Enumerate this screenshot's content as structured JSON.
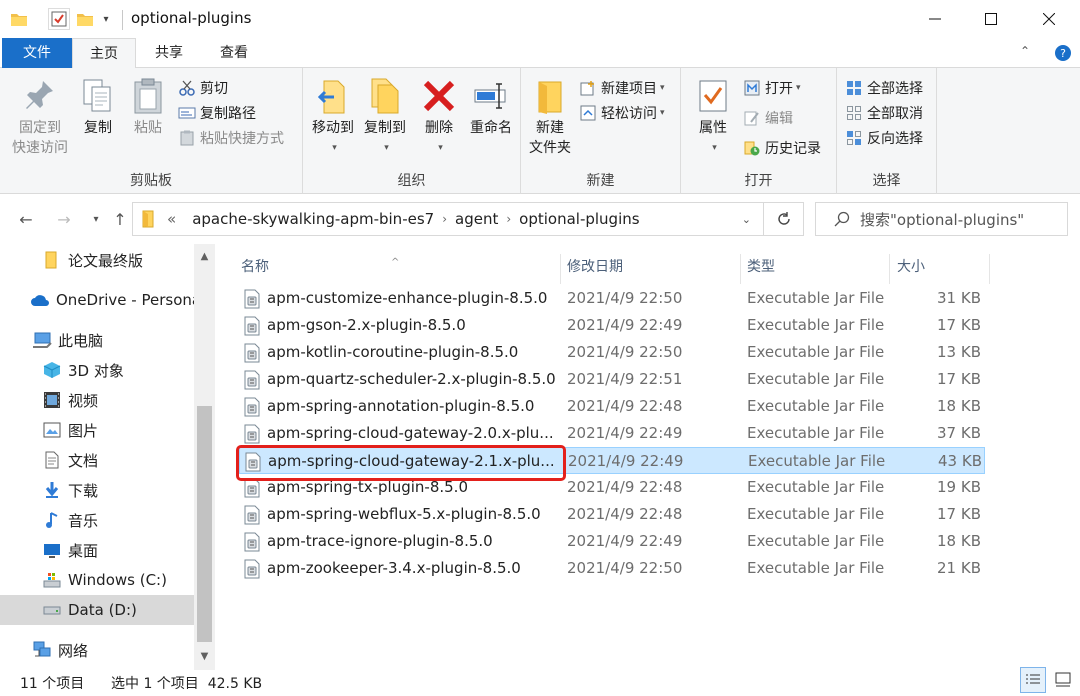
{
  "window": {
    "title": "optional-plugins"
  },
  "tabs": {
    "file": "文件",
    "home": "主页",
    "share": "共享",
    "view": "查看"
  },
  "ribbon": {
    "clipboard": {
      "label": "剪贴板",
      "pin": "固定到\n快速访问",
      "pin_line1": "固定到",
      "pin_line2": "快速访问",
      "copy": "复制",
      "paste": "粘贴",
      "cut": "剪切",
      "copy_path": "复制路径",
      "paste_shortcut": "粘贴快捷方式"
    },
    "organize": {
      "label": "组织",
      "move_to": "移动到",
      "copy_to": "复制到",
      "delete": "删除",
      "rename": "重命名"
    },
    "new": {
      "label": "新建",
      "new_folder_line1": "新建",
      "new_folder_line2": "文件夹",
      "new_item": "新建项目",
      "easy_access": "轻松访问"
    },
    "open": {
      "label": "打开",
      "properties": "属性",
      "open": "打开",
      "edit": "编辑",
      "history": "历史记录"
    },
    "select": {
      "label": "选择",
      "select_all": "全部选择",
      "select_none": "全部取消",
      "invert": "反向选择"
    }
  },
  "address": {
    "overflow": "«",
    "crumbs": [
      "apache-skywalking-apm-bin-es7",
      "agent",
      "optional-plugins"
    ],
    "search_placeholder": "搜索\"optional-plugins\""
  },
  "sidebar": {
    "items": [
      {
        "label": "论文最终版",
        "icon": "folder-icon"
      },
      {
        "label": "OneDrive - Persona",
        "icon": "cloud-icon"
      },
      {
        "label": "此电脑",
        "icon": "computer-icon"
      },
      {
        "label": "3D 对象",
        "icon": "3d-objects-icon"
      },
      {
        "label": "视频",
        "icon": "video-icon"
      },
      {
        "label": "图片",
        "icon": "pictures-icon"
      },
      {
        "label": "文档",
        "icon": "documents-icon"
      },
      {
        "label": "下载",
        "icon": "download-icon"
      },
      {
        "label": "音乐",
        "icon": "music-icon"
      },
      {
        "label": "桌面",
        "icon": "desktop-icon"
      },
      {
        "label": "Windows (C:)",
        "icon": "drive-c-icon"
      },
      {
        "label": "Data (D:)",
        "icon": "drive-d-icon"
      },
      {
        "label": "网络",
        "icon": "network-icon"
      }
    ]
  },
  "filelist": {
    "columns": {
      "name": "名称",
      "date": "修改日期",
      "type": "类型",
      "size": "大小"
    },
    "rows": [
      {
        "name": "apm-customize-enhance-plugin-8.5.0",
        "date": "2021/4/9 22:50",
        "type": "Executable Jar File",
        "size": "31 KB"
      },
      {
        "name": "apm-gson-2.x-plugin-8.5.0",
        "date": "2021/4/9 22:49",
        "type": "Executable Jar File",
        "size": "17 KB"
      },
      {
        "name": "apm-kotlin-coroutine-plugin-8.5.0",
        "date": "2021/4/9 22:50",
        "type": "Executable Jar File",
        "size": "13 KB"
      },
      {
        "name": "apm-quartz-scheduler-2.x-plugin-8.5.0",
        "date": "2021/4/9 22:51",
        "type": "Executable Jar File",
        "size": "17 KB"
      },
      {
        "name": "apm-spring-annotation-plugin-8.5.0",
        "date": "2021/4/9 22:48",
        "type": "Executable Jar File",
        "size": "18 KB"
      },
      {
        "name": "apm-spring-cloud-gateway-2.0.x-plu...",
        "date": "2021/4/9 22:49",
        "type": "Executable Jar File",
        "size": "37 KB"
      },
      {
        "name": "apm-spring-cloud-gateway-2.1.x-plu...",
        "date": "2021/4/9 22:49",
        "type": "Executable Jar File",
        "size": "43 KB"
      },
      {
        "name": "apm-spring-tx-plugin-8.5.0",
        "date": "2021/4/9 22:48",
        "type": "Executable Jar File",
        "size": "19 KB"
      },
      {
        "name": "apm-spring-webflux-5.x-plugin-8.5.0",
        "date": "2021/4/9 22:48",
        "type": "Executable Jar File",
        "size": "17 KB"
      },
      {
        "name": "apm-trace-ignore-plugin-8.5.0",
        "date": "2021/4/9 22:49",
        "type": "Executable Jar File",
        "size": "18 KB"
      },
      {
        "name": "apm-zookeeper-3.4.x-plugin-8.5.0",
        "date": "2021/4/9 22:50",
        "type": "Executable Jar File",
        "size": "21 KB"
      }
    ]
  },
  "status": {
    "count": "11 个项目",
    "selected": "选中 1 个项目  42.5 KB"
  },
  "colors": {
    "accent": "#1a6fc9",
    "selection": "#cce8ff",
    "highlight_box": "#e3201b"
  }
}
